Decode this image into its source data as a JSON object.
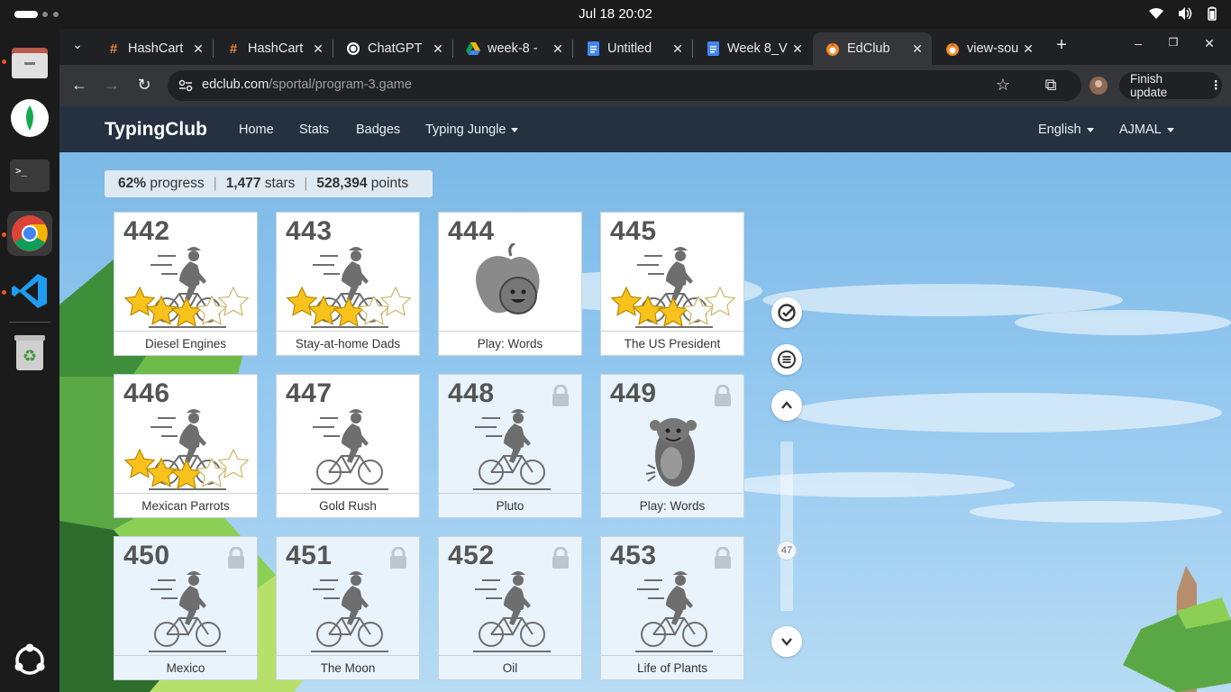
{
  "system": {
    "clock": "Jul 18  20:02"
  },
  "browser": {
    "tabs": [
      {
        "title": "HashCart",
        "icon": "hash-icon"
      },
      {
        "title": "HashCart",
        "icon": "hash-icon"
      },
      {
        "title": "ChatGPT",
        "icon": "chatgpt-icon"
      },
      {
        "title": "week-8 -",
        "icon": "drive-icon"
      },
      {
        "title": "Untitled",
        "icon": "docs-icon"
      },
      {
        "title": "Week 8_V",
        "icon": "docs-icon"
      },
      {
        "title": "EdClub",
        "icon": "edclub-icon"
      },
      {
        "title": "view-sou",
        "icon": "edclub-icon"
      }
    ],
    "url_host": "edclub.com",
    "url_path": "/sportal/program-3.game",
    "finish_update_label": "Finish update"
  },
  "app": {
    "brand": "TypingClub",
    "nav": {
      "home": "Home",
      "stats": "Stats",
      "badges": "Badges",
      "course": "Typing Jungle",
      "language": "English",
      "user": "AJMAL"
    },
    "stats": {
      "progress_value": "62%",
      "progress_label": "progress",
      "stars_value": "1,477",
      "stars_label": "stars",
      "points_value": "528,394",
      "points_label": "points"
    },
    "lessons": [
      {
        "number": "442",
        "title": "Diesel Engines",
        "stars": 3,
        "locked": false,
        "art": "bike"
      },
      {
        "number": "443",
        "title": "Stay-at-home Dads",
        "stars": 3,
        "locked": false,
        "art": "bike"
      },
      {
        "number": "444",
        "title": "Play: Words",
        "stars": 0,
        "locked": false,
        "art": "apple"
      },
      {
        "number": "445",
        "title": "The US President",
        "stars": 3,
        "locked": false,
        "art": "bike"
      },
      {
        "number": "446",
        "title": "Mexican Parrots",
        "stars": 3,
        "locked": false,
        "art": "bike"
      },
      {
        "number": "447",
        "title": "Gold Rush",
        "stars": 0,
        "locked": false,
        "art": "bike"
      },
      {
        "number": "448",
        "title": "Pluto",
        "stars": 0,
        "locked": true,
        "art": "bike"
      },
      {
        "number": "449",
        "title": "Play: Words",
        "stars": 0,
        "locked": true,
        "art": "monkey"
      },
      {
        "number": "450",
        "title": "Mexico",
        "stars": 0,
        "locked": true,
        "art": "bike"
      },
      {
        "number": "451",
        "title": "The Moon",
        "stars": 0,
        "locked": true,
        "art": "bike"
      },
      {
        "number": "452",
        "title": "Oil",
        "stars": 0,
        "locked": true,
        "art": "bike"
      },
      {
        "number": "453",
        "title": "Life of Plants",
        "stars": 0,
        "locked": true,
        "art": "bike"
      }
    ],
    "scroll_position": "47"
  },
  "colors": {
    "navbar": "#253140",
    "sky": "#8ec5ee",
    "star": "#f7c21b",
    "accent": "#e95420"
  }
}
